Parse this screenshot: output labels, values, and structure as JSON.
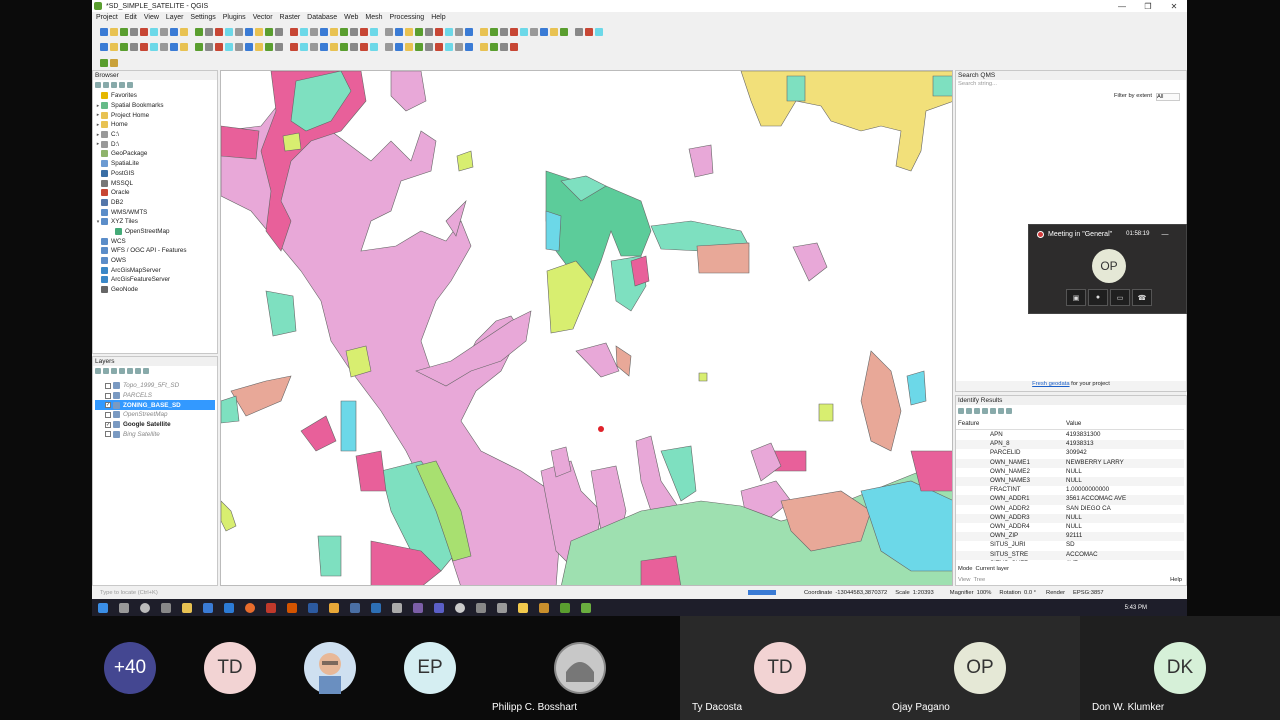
{
  "window": {
    "title": "*SD_SIMPLE_SATELITE - QGIS",
    "controls": [
      "—",
      "❐",
      "✕"
    ]
  },
  "menu": [
    "Project",
    "Edit",
    "View",
    "Layer",
    "Settings",
    "Plugins",
    "Vector",
    "Raster",
    "Database",
    "Web",
    "Mesh",
    "Processing",
    "Help"
  ],
  "browser": {
    "title": "Browser",
    "items": [
      {
        "label": "Favorites",
        "icon": "star-icon",
        "color": "#e5b700",
        "arrow": ""
      },
      {
        "label": "Spatial Bookmarks",
        "icon": "bookmark-icon",
        "color": "#6b8",
        "arrow": "▸"
      },
      {
        "label": "Project Home",
        "icon": "folder-icon",
        "color": "#e8c252",
        "arrow": "▸"
      },
      {
        "label": "Home",
        "icon": "folder-icon",
        "color": "#e8c252",
        "arrow": "▸"
      },
      {
        "label": "C:\\",
        "icon": "drive-icon",
        "color": "#999",
        "arrow": "▸"
      },
      {
        "label": "D:\\",
        "icon": "drive-icon",
        "color": "#999",
        "arrow": "▸"
      },
      {
        "label": "GeoPackage",
        "icon": "geopackage-icon",
        "color": "#8fb36b",
        "arrow": ""
      },
      {
        "label": "SpatiaLite",
        "icon": "spatialite-icon",
        "color": "#6c9bd2",
        "arrow": ""
      },
      {
        "label": "PostGIS",
        "icon": "postgis-icon",
        "color": "#3a6ea5",
        "arrow": ""
      },
      {
        "label": "MSSQL",
        "icon": "mssql-icon",
        "color": "#777",
        "arrow": ""
      },
      {
        "label": "Oracle",
        "icon": "oracle-icon",
        "color": "#c74634",
        "arrow": ""
      },
      {
        "label": "DB2",
        "icon": "db2-icon",
        "color": "#5577aa",
        "arrow": ""
      },
      {
        "label": "WMS/WMTS",
        "icon": "wms-icon",
        "color": "#5b8dc9",
        "arrow": ""
      },
      {
        "label": "XYZ Tiles",
        "icon": "xyz-tiles-icon",
        "color": "#5b8dc9",
        "arrow": "▾"
      },
      {
        "label": "OpenStreetMap",
        "icon": "osm-icon",
        "color": "#4a7",
        "arrow": "",
        "indent": true
      },
      {
        "label": "WCS",
        "icon": "wcs-icon",
        "color": "#5b8dc9",
        "arrow": ""
      },
      {
        "label": "WFS / OGC API - Features",
        "icon": "wfs-icon",
        "color": "#5b8dc9",
        "arrow": ""
      },
      {
        "label": "OWS",
        "icon": "ows-icon",
        "color": "#5b8dc9",
        "arrow": ""
      },
      {
        "label": "ArcGisMapServer",
        "icon": "arcgis-icon",
        "color": "#3a88c8",
        "arrow": ""
      },
      {
        "label": "ArcGisFeatureServer",
        "icon": "arcgis-icon",
        "color": "#3a88c8",
        "arrow": ""
      },
      {
        "label": "GeoNode",
        "icon": "geonode-icon",
        "color": "#666",
        "arrow": ""
      }
    ]
  },
  "layers": {
    "title": "Layers",
    "items": [
      {
        "label": "Topo_1999_5Ft_SD",
        "checked": false,
        "style": "italic-grey"
      },
      {
        "label": "PARCELS",
        "checked": false,
        "style": "italic-grey"
      },
      {
        "label": "ZONING_BASE_SD",
        "checked": true,
        "style": "selected"
      },
      {
        "label": "OpenStreetMap",
        "checked": false,
        "style": "italic-grey"
      },
      {
        "label": "Google Satellite",
        "checked": true,
        "style": "bold"
      },
      {
        "label": "Bing Satellite",
        "checked": false,
        "style": "italic-grey"
      }
    ]
  },
  "search_qms": {
    "title": "Search QMS",
    "placeholder": "Search string...",
    "filter_label": "Filter by extent",
    "filter_value": "All",
    "fresh_link": "Fresh geodata",
    "fresh_suffix": " for your project"
  },
  "identify": {
    "title": "Identify Results",
    "col_feature": "Feature",
    "col_value": "Value",
    "rows": [
      {
        "k": "APN",
        "v": "4193831300"
      },
      {
        "k": "APN_8",
        "v": "41938313"
      },
      {
        "k": "PARCELID",
        "v": "309942"
      },
      {
        "k": "OWN_NAME1",
        "v": "NEWBERRY LARRY"
      },
      {
        "k": "OWN_NAME2",
        "v": "NULL"
      },
      {
        "k": "OWN_NAME3",
        "v": "NULL"
      },
      {
        "k": "FRACTINT",
        "v": "1.00000000000"
      },
      {
        "k": "OWN_ADDR1",
        "v": "3561 ACCOMAC AVE"
      },
      {
        "k": "OWN_ADDR2",
        "v": "SAN DIEGO CA"
      },
      {
        "k": "OWN_ADDR3",
        "v": "NULL"
      },
      {
        "k": "OWN_ADDR4",
        "v": "NULL"
      },
      {
        "k": "OWN_ZIP",
        "v": "92111"
      },
      {
        "k": "SITUS_JURI",
        "v": "SD"
      },
      {
        "k": "SITUS_STRE",
        "v": "ACCOMAC"
      },
      {
        "k": "SITUS_SUFF",
        "v": "AVE"
      }
    ],
    "mode_label": "Mode",
    "mode_value": "Current layer",
    "view_label": "View",
    "view_value": "Tree",
    "help": "Help"
  },
  "statusbar": {
    "locate_placeholder": "Type to locate (Ctrl+K)",
    "coordinate_label": "Coordinate",
    "coordinate_value": "-13044583,3870372",
    "scale_label": "Scale",
    "scale_value": "1:20393",
    "magnifier_label": "Magnifier",
    "magnifier_value": "100%",
    "rotation_label": "Rotation",
    "rotation_value": "0.0 °",
    "render_label": "Render",
    "crs": "EPSG:3857"
  },
  "taskbar": {
    "clock": "5:43 PM"
  },
  "meeting": {
    "title": "Meeting in \"General\"",
    "timer": "01:58:19",
    "avatar": "OP"
  },
  "participants": [
    {
      "initials": "+40",
      "name": ""
    },
    {
      "initials": "TD",
      "name": ""
    },
    {
      "initials": "",
      "name": ""
    },
    {
      "initials": "EP",
      "name": ""
    },
    {
      "initials": "",
      "name": "Philipp C. Bosshart"
    },
    {
      "initials": "TD",
      "name": "Ty Dacosta"
    },
    {
      "initials": "OP",
      "name": "Ojay Pagano"
    },
    {
      "initials": "DK",
      "name": "Don W. Klumker"
    }
  ],
  "colors": {
    "pink": "#e8a8d8",
    "magenta": "#e8609a",
    "mint": "#7ee0c0",
    "green": "#5ccc9a",
    "yellowgreen": "#d8ee70",
    "salmon": "#e8a898",
    "cyan": "#6cd8e8",
    "selection": "#3399ff"
  }
}
